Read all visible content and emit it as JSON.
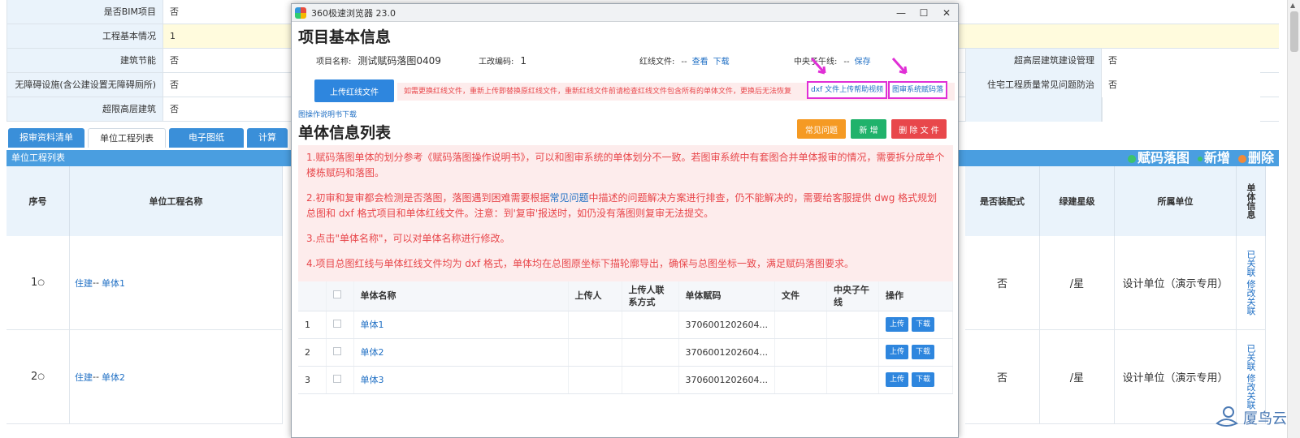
{
  "bg": {
    "form_rows": [
      {
        "label": "是否BIM项目",
        "value": "否"
      },
      {
        "label": "工程基本情况",
        "value": "1"
      },
      {
        "label": "建筑节能",
        "value": "否"
      },
      {
        "label": "无障碍设施(含公建设置无障碍厕所)",
        "value": "否"
      },
      {
        "label": "超限高层建筑",
        "value": "否"
      }
    ],
    "right_fields": [
      {
        "label": "超高层建筑建设管理",
        "value": "否"
      },
      {
        "label": "住宅工程质量常见问题防治",
        "value": "否"
      }
    ],
    "tabs": [
      "报审资料清单",
      "单位工程列表",
      "电子图纸",
      "计算"
    ],
    "list_title": "单位工程列表",
    "list_actions": [
      "赋码落图",
      "新增",
      "删除"
    ],
    "columns": {
      "no": "序号",
      "name": "单位工程名称",
      "prefab": "是否装配式",
      "green": "绿建星级",
      "unit": "所属单位",
      "info": "单体信息"
    },
    "rows": [
      {
        "no": "1",
        "prefix": "住建",
        "sep": "--",
        "name": "单体1",
        "prefab": "否",
        "green": "/星",
        "unit": "设计单位（演示专用）",
        "links": "已关联 修改关联"
      },
      {
        "no": "2",
        "prefix": "住建",
        "sep": "--",
        "name": "单体2",
        "prefab": "否",
        "green": "/星",
        "unit": "设计单位（演示专用）",
        "links": "已关联 修改关联"
      }
    ],
    "watermark": "厦鸟云"
  },
  "popup": {
    "window_title": "360极速浏览器 23.0",
    "controls": [
      "—",
      "☐",
      "✕"
    ],
    "title": "项目基本信息",
    "info": {
      "name_label": "项目名称:",
      "name_value": "测试赋码落图0409",
      "code_label": "工改编码:",
      "code_value": "1",
      "redline_label": "红线文件:",
      "redline_value": "--",
      "view": "查看",
      "download": "下载",
      "meridian_label": "中央子午线:",
      "meridian_value": "--",
      "save": "保存"
    },
    "upload_btn": "上传红线文件",
    "warn": "如需更换红线文件，重新上传即替换原红线文件，重新红线文件前请检查红线文件包含所有的单体文件，更换后无法恢复",
    "dxf_link": "dxf 文件上传帮助视频",
    "map_link": "图审系统赋码落",
    "help_link": "图操作说明书下载",
    "list_title": "单体信息列表",
    "buttons": {
      "faq": "常见问题",
      "add": "新 增",
      "delete": "删 除 文 件"
    },
    "notice": {
      "p1": "1.赋码落图单体的划分参考《赋码落图操作说明书》，可以和图审系统的单体划分不一致。若图审系统中有套图合并单体报审的情况，需要拆分成单个楼栋赋码和落图。",
      "p2a": "2.初审和复审都会检测是否落图，落图遇到困难需要根据",
      "p2link": "常见问题",
      "p2b": "中描述的问题解决方案进行排查，仍不能解决的，需要给客服提供 dwg 格式规划总图和 dxf 格式项目和单体红线文件。注意：到'复审'报送时，如仍没有落图则复审无法提交。",
      "p3": "3.点击\"单体名称\"，可以对单体名称进行修改。",
      "p4": "4.项目总图红线与单体红线文件均为 dxf 格式，单体均在总图原坐标下描轮廓导出，确保与总图坐标一致，满足赋码落图要求。"
    },
    "table": {
      "headers": [
        "单体名称",
        "上传人",
        "上传人联系方式",
        "单体赋码",
        "文件",
        "中央子午线",
        "操作"
      ],
      "rows": [
        {
          "no": "1",
          "name": "单体1",
          "code": "3706001202604..."
        },
        {
          "no": "2",
          "name": "单体2",
          "code": "3706001202604..."
        },
        {
          "no": "3",
          "name": "单体3",
          "code": "3706001202604..."
        }
      ],
      "upload": "上传",
      "download": "下载"
    }
  },
  "colors": {
    "accent": "#2e86de",
    "warn": "#e8474b",
    "highlight": "#e02fd6"
  }
}
